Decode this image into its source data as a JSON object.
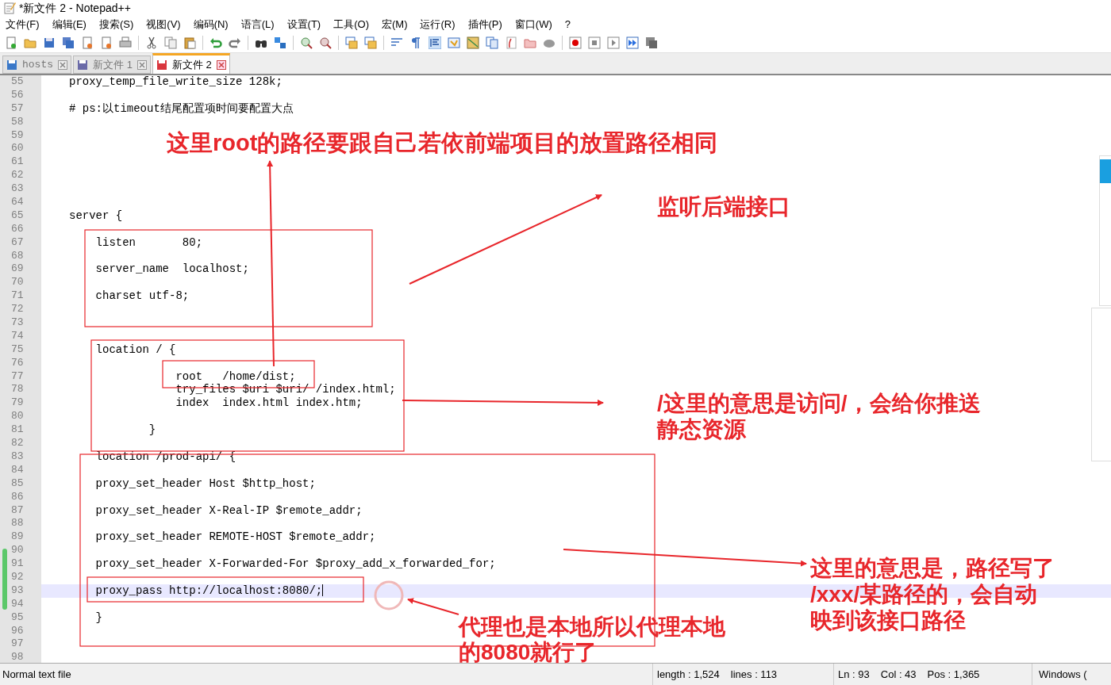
{
  "window": {
    "title": "*新文件 2 - Notepad++"
  },
  "menu": [
    "文件(F)",
    "编辑(E)",
    "搜索(S)",
    "视图(V)",
    "编码(N)",
    "语言(L)",
    "设置(T)",
    "工具(O)",
    "宏(M)",
    "运行(R)",
    "插件(P)",
    "窗口(W)",
    "?"
  ],
  "tabs": [
    {
      "label": "hosts",
      "selected": false,
      "modified": false
    },
    {
      "label": "新文件 1",
      "selected": false,
      "modified": false
    },
    {
      "label": "新文件 2",
      "selected": true,
      "modified": true
    }
  ],
  "editor": {
    "lines": [
      {
        "number": "55",
        "text": "proxy_temp_file_write_size 128k;",
        "current": false
      },
      {
        "number": "56",
        "current": false
      },
      {
        "number": "57",
        "text": "# ps:以timeout结尾配置项时间要配置大点",
        "current": false
      },
      {
        "number": "58",
        "current": false
      },
      {
        "number": "59",
        "current": false
      },
      {
        "number": "60",
        "current": false
      },
      {
        "number": "61",
        "current": false
      },
      {
        "number": "62",
        "current": false
      },
      {
        "number": "63",
        "current": false
      },
      {
        "number": "64",
        "current": false
      },
      {
        "number": "65",
        "text": "server {",
        "current": false
      },
      {
        "number": "66",
        "current": false
      },
      {
        "number": "67",
        "text": "    listen       80;",
        "current": false
      },
      {
        "number": "68",
        "current": false
      },
      {
        "number": "69",
        "text": "    server_name  localhost;",
        "current": false
      },
      {
        "number": "70",
        "current": false
      },
      {
        "number": "71",
        "text": "    charset utf-8;",
        "current": false
      },
      {
        "number": "72",
        "current": false
      },
      {
        "number": "73",
        "current": false
      },
      {
        "number": "74",
        "current": false
      },
      {
        "number": "75",
        "text": "    location / {",
        "current": false
      },
      {
        "number": "76",
        "current": false
      },
      {
        "number": "77",
        "text": "                root   /home/dist;",
        "current": false
      },
      {
        "number": "78",
        "text": "                try_files $uri $uri/ /index.html;",
        "current": false
      },
      {
        "number": "79",
        "text": "                index  index.html index.htm;",
        "current": false
      },
      {
        "number": "80",
        "current": false
      },
      {
        "number": "81",
        "text": "            }",
        "current": false
      },
      {
        "number": "82",
        "current": false
      },
      {
        "number": "83",
        "text": "    location /prod-api/ {",
        "current": false
      },
      {
        "number": "84",
        "current": false
      },
      {
        "number": "85",
        "text": "    proxy_set_header Host $http_host;",
        "current": false
      },
      {
        "number": "86",
        "current": false
      },
      {
        "number": "87",
        "text": "    proxy_set_header X-Real-IP $remote_addr;",
        "current": false
      },
      {
        "number": "88",
        "current": false
      },
      {
        "number": "89",
        "text": "    proxy_set_header REMOTE-HOST $remote_addr;",
        "current": false
      },
      {
        "number": "90",
        "current": false
      },
      {
        "number": "91",
        "text": "    proxy_set_header X-Forwarded-For $proxy_add_x_forwarded_for;",
        "current": false
      },
      {
        "number": "92",
        "current": false
      },
      {
        "number": "93",
        "text": "    proxy_pass http://localhost:8080/;",
        "current": true
      },
      {
        "number": "94",
        "current": false
      },
      {
        "number": "95",
        "text": "    }",
        "current": false
      },
      {
        "number": "96",
        "current": false
      },
      {
        "number": "97",
        "current": false
      },
      {
        "number": "98",
        "current": false
      }
    ]
  },
  "annotations": [
    {
      "lines": [
        "这里root的路径要跟自己若依前端项目的放置路径相同"
      ]
    },
    {
      "lines": [
        "监听后端接口"
      ]
    },
    {
      "lines": [
        "/这里的意思是访问/，会给你推送",
        "静态资源"
      ]
    },
    {
      "lines": [
        "这里的意思是，路径写了",
        "/xxx/某路径的，会自动",
        "映到该接口路径"
      ]
    },
    {
      "lines": [
        "代理也是本地所以代理本地",
        "的8080就行了"
      ]
    }
  ],
  "status_bar": {
    "file_type": "Normal text file",
    "length": "length : 1,524",
    "lines": "lines : 113",
    "ln": "Ln : 93",
    "col": "Col : 43",
    "pos": "Pos : 1,365",
    "eol": "Windows ("
  }
}
